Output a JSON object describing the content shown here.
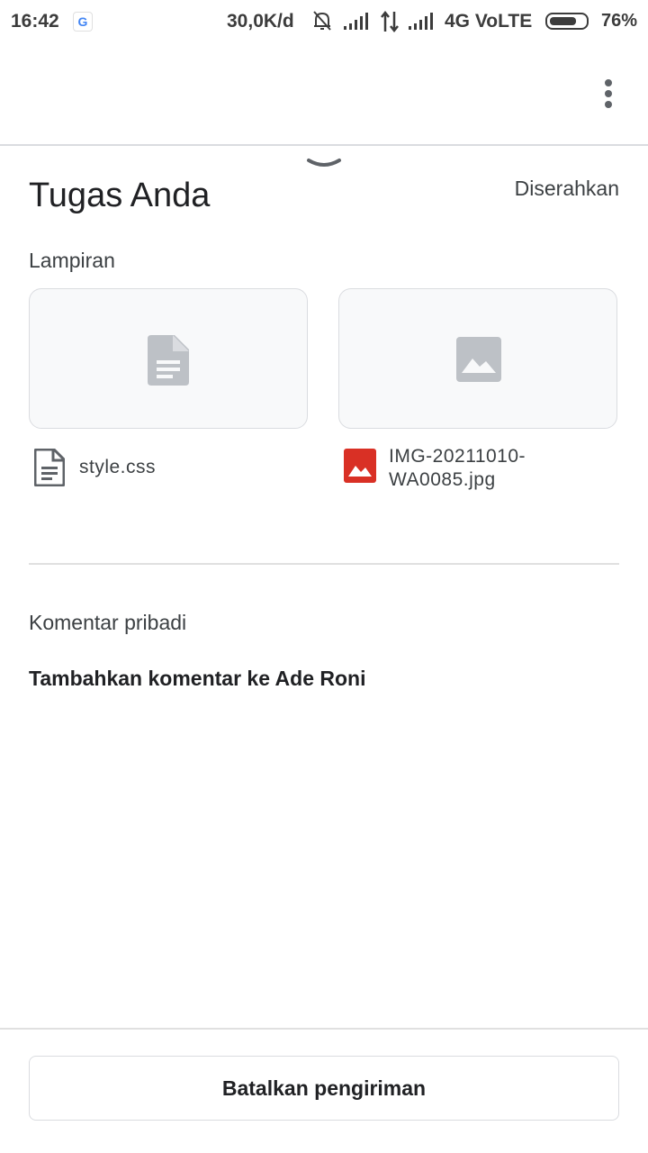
{
  "status_bar": {
    "time": "16:42",
    "google_badge": "G",
    "speed": "30,0K/d",
    "network": "4G VoLTE",
    "battery": "76%",
    "battery_level": 0.76
  },
  "icons": {
    "more": "more-vert-icon",
    "handle": "chevron-down-icon",
    "doc": "document-icon",
    "image": "image-icon"
  },
  "assignment": {
    "title": "Tugas Anda",
    "status": "Diserahkan"
  },
  "attachments": {
    "label": "Lampiran",
    "items": [
      {
        "name": "style.css",
        "type": "document"
      },
      {
        "name": "IMG-20211010-\nWA0085.jpg",
        "type": "image"
      }
    ]
  },
  "comments": {
    "label": "Komentar pribadi",
    "placeholder": "Tambahkan komentar ke Ade Roni"
  },
  "actions": {
    "cancel_label": "Batalkan pengiriman"
  },
  "colors": {
    "image_red": "#d93025",
    "placeholder_gray": "#bdc1c6"
  }
}
